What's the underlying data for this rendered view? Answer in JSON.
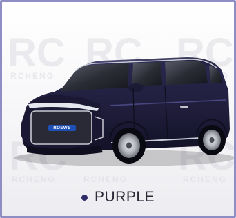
{
  "car": {
    "badge_text": "ROEWE",
    "color_name": "PURPLE",
    "color_hex": "#1f1d3a",
    "dot_hex": "#2f2c6a"
  },
  "watermark": {
    "text": "RCHENG",
    "logo": "RC"
  },
  "frame": {
    "border_hex": "#8f8ec4"
  }
}
